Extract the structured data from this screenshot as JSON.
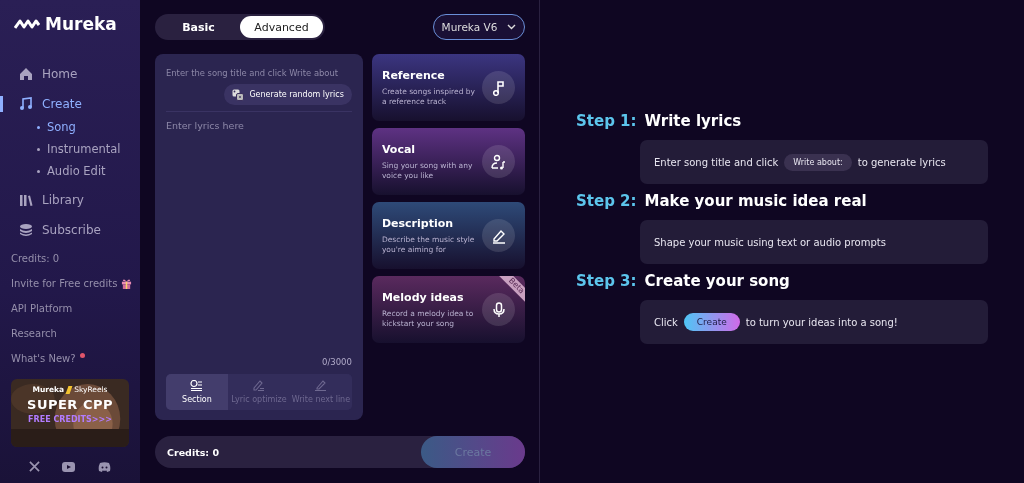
{
  "sidebar": {
    "logo": "Mureka",
    "nav": [
      {
        "label": "Home",
        "selected": false
      },
      {
        "label": "Create",
        "selected": true,
        "children": [
          {
            "label": "Song",
            "selected": true
          },
          {
            "label": "Instrumental",
            "selected": false
          },
          {
            "label": "Audio Edit",
            "selected": false
          }
        ]
      },
      {
        "label": "Library",
        "selected": false
      },
      {
        "label": "Subscribe",
        "selected": false
      }
    ],
    "links": [
      {
        "label": "Credits: 0",
        "kind": "plain"
      },
      {
        "label": "Invite for Free credits",
        "kind": "gift"
      },
      {
        "label": "API Platform",
        "kind": "plain"
      },
      {
        "label": "Research",
        "kind": "plain"
      },
      {
        "label": "What's New?",
        "kind": "new"
      }
    ],
    "promo": {
      "brand_1": "Mureka",
      "brand_2": "SkyReels",
      "headline": "SUPER CPP",
      "tagline": "FREE CREDITS>>>"
    }
  },
  "mode_tabs": [
    {
      "label": "Basic",
      "selected": false
    },
    {
      "label": "Advanced",
      "selected": true
    }
  ],
  "model_select": {
    "value": "Mureka V6"
  },
  "lyrics": {
    "title_placeholder": "Enter the song title and click Write about",
    "random_button": "Generate random lyrics",
    "lyrics_placeholder": "Enter lyrics here",
    "counter": "0/3000",
    "tools": [
      {
        "label": "Section",
        "disabled": false
      },
      {
        "label": "Lyric optimize",
        "disabled": true
      },
      {
        "label": "Write next line",
        "disabled": true
      }
    ]
  },
  "option_cards": [
    {
      "title": "Reference",
      "description": "Create songs inspired by a reference track",
      "color": "#3b3580"
    },
    {
      "title": "Vocal",
      "description": "Sing your song with any voice you like",
      "color": "#5e3283"
    },
    {
      "title": "Description",
      "description": "Describe the music style you're aiming for",
      "color": "#2e4a78"
    },
    {
      "title": "Melody ideas",
      "description": "Record a melody idea to kickstart your song",
      "color": "#5a2a5e",
      "badge": "Beta"
    }
  ],
  "footer": {
    "credits": "Credits: 0",
    "create_button": {
      "label": "Create",
      "disabled": true
    }
  },
  "steps": [
    {
      "number": "Step 1:",
      "title": "Write lyrics",
      "parts": [
        {
          "kind": "text",
          "text": "Enter song title and click"
        },
        {
          "kind": "chip",
          "text": "Write about:"
        },
        {
          "kind": "text",
          "text": "to generate lyrics"
        }
      ]
    },
    {
      "number": "Step 2:",
      "title": "Make your music idea real",
      "parts": [
        {
          "kind": "text",
          "text": "Shape your music using text or audio prompts"
        }
      ]
    },
    {
      "number": "Step 3:",
      "title": "Create your song",
      "parts": [
        {
          "kind": "text",
          "text": "Click"
        },
        {
          "kind": "button",
          "text": "Create"
        },
        {
          "kind": "text",
          "text": "to turn your ideas into a song!"
        }
      ]
    }
  ]
}
